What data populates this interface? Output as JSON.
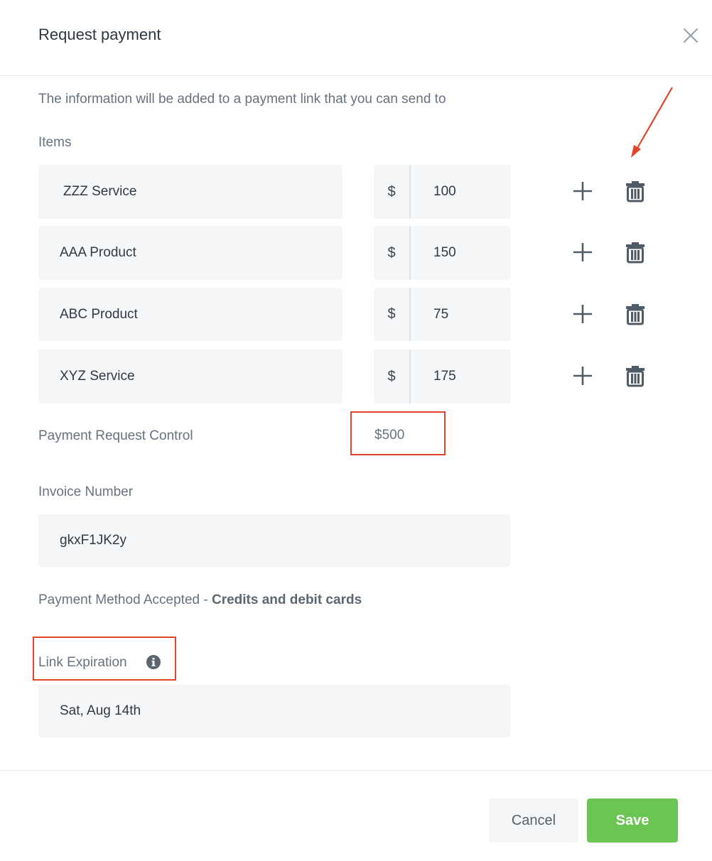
{
  "dialog": {
    "title": "Request payment",
    "close_icon": "close-icon",
    "intro": "The information will be added to a payment link that you can send to"
  },
  "items": {
    "label": "Items",
    "currency": "$",
    "add_icon": "plus-icon",
    "delete_icon": "trash-icon",
    "rows": [
      {
        "name": "ZZZ Service",
        "price": "100"
      },
      {
        "name": "AAA Product",
        "price": "150"
      },
      {
        "name": "ABC Product",
        "price": "75"
      },
      {
        "name": "XYZ Service",
        "price": "175"
      }
    ]
  },
  "payment_request_control": {
    "label": "Payment Request Control",
    "total": "$500"
  },
  "invoice": {
    "label": "Invoice Number",
    "value": "gkxF1JK2y"
  },
  "payment_method": {
    "label": "Payment Method Accepted - ",
    "value": "Credits and debit cards"
  },
  "link_expiration": {
    "label": "Link Expiration",
    "info_icon": "info-icon",
    "value": "Sat, Aug 14th"
  },
  "footer": {
    "cancel_label": "Cancel",
    "save_label": "Save"
  },
  "colors": {
    "save_button": "#6ac553",
    "annotation": "#e0452c",
    "field_background": "#f4f6f8"
  }
}
